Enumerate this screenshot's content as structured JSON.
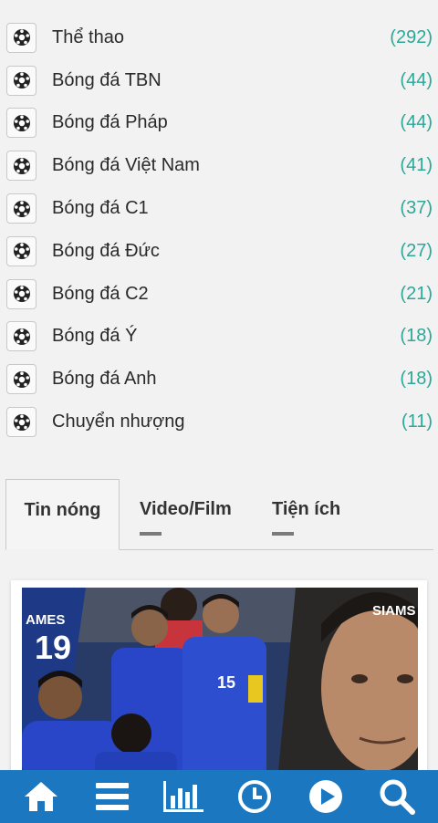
{
  "categories": [
    {
      "label": "Thể thao",
      "count": "(292)"
    },
    {
      "label": "Bóng đá TBN",
      "count": "(44)"
    },
    {
      "label": "Bóng đá Pháp",
      "count": "(44)"
    },
    {
      "label": "Bóng đá Việt Nam",
      "count": "(41)"
    },
    {
      "label": "Bóng đá C1",
      "count": "(37)"
    },
    {
      "label": "Bóng đá Đức",
      "count": "(27)"
    },
    {
      "label": "Bóng đá C2",
      "count": "(21)"
    },
    {
      "label": "Bóng đá Ý",
      "count": "(18)"
    },
    {
      "label": "Bóng đá Anh",
      "count": "(18)"
    },
    {
      "label": "Chuyển nhượng",
      "count": "(11)"
    }
  ],
  "category_icon": "soccer-ball-icon",
  "tabs": {
    "hot": "Tin nóng",
    "video": "Video/Film",
    "utilities": "Tiện ích"
  },
  "article": {
    "image_text_left": "AMES",
    "image_text_year": "19",
    "image_text_right": "SIAMS",
    "jersey_number": "15"
  },
  "bottom_nav": [
    "home-icon",
    "menu-icon",
    "chart-icon",
    "clock-icon",
    "play-icon",
    "search-icon"
  ],
  "colors": {
    "accent": "#2aa898",
    "nav_bg": "#1b78c0",
    "background": "#f2f2f2"
  }
}
